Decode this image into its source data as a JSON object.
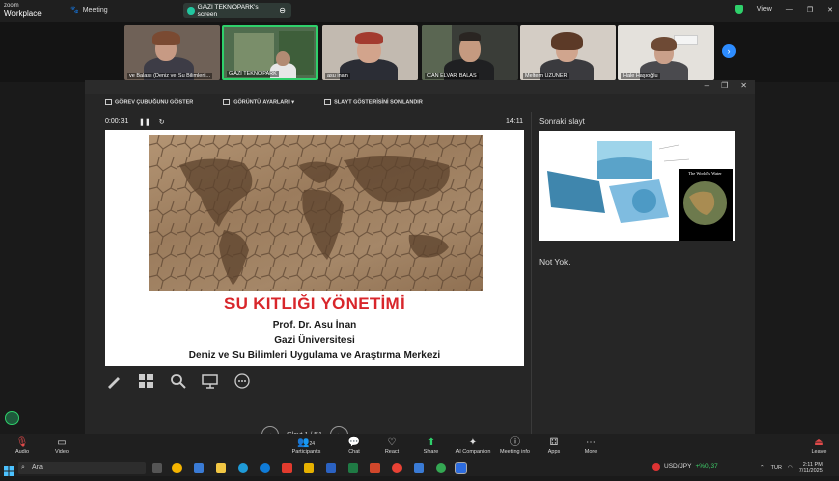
{
  "zoom": {
    "brand_line1": "zoom",
    "brand_line2": "Workplace",
    "meeting_label": "Meeting",
    "screen_tab": "GAZI TEKNOPARK's screen",
    "view_label": "View"
  },
  "participants": [
    {
      "name": "ve Balası (Deniz ve Su Bilimleri...",
      "bg": "#7b6d62"
    },
    {
      "name": "GAZI TEKNOPARK",
      "bg": "#4f6a4a"
    },
    {
      "name": "asu inan",
      "bg": "#b9b0a4"
    },
    {
      "name": "CAN ELVAR BALAS",
      "bg": "#3b3f3a"
    },
    {
      "name": "Meltem UZUNER",
      "bg": "#cfc6bd"
    },
    {
      "name": "Hale Haşıoğlu",
      "bg": "#e2dfda"
    }
  ],
  "presenter": {
    "toolbar": {
      "taskbar": "GÖREV ÇUBUĞUNU GÖSTER",
      "display": "GÖRÜNTÜ AYARLARI ▾",
      "end": "SLAYT GÖSTERİSİNİ SONLANDIR"
    },
    "timer": "0:00:31",
    "clock": "14:11",
    "next_slide_label": "Sonraki slayt",
    "notes": "Not Yok.",
    "nav_text": "Slayt 1 / 51"
  },
  "slide": {
    "title": "SU KITLIĞI YÖNETİMİ",
    "author": "Prof. Dr. Asu İnan",
    "university": "Gazi Üniversitesi",
    "center": "Deniz ve Su Bilimleri Uygulama ve Araştırma Merkezi"
  },
  "next_slide": {
    "globe_caption": "The World's Water"
  },
  "toolbar": [
    {
      "label": "Audio",
      "icon": "mic-off-icon"
    },
    {
      "label": "Video",
      "icon": "camera-icon"
    },
    {
      "label": "Participants",
      "icon": "people-icon",
      "count": "24"
    },
    {
      "label": "Chat",
      "icon": "chat-icon"
    },
    {
      "label": "React",
      "icon": "heart-icon"
    },
    {
      "label": "Share",
      "icon": "share-icon"
    },
    {
      "label": "AI Companion",
      "icon": "sparkle-icon"
    },
    {
      "label": "Meeting info",
      "icon": "info-icon"
    },
    {
      "label": "Apps",
      "icon": "apps-icon"
    },
    {
      "label": "More",
      "icon": "more-icon"
    },
    {
      "label": "Leave",
      "icon": "leave-icon"
    }
  ],
  "taskbar": {
    "search_placeholder": "Ara",
    "ticker": "USD/JPY",
    "ticker_change": "+%0,37",
    "lang": "TUR",
    "time": "2:11 PM",
    "date": "7/11/2025"
  },
  "colors": {
    "accent": "#2d8cff",
    "title_red": "#d8262b",
    "active_green": "#2fd06b"
  }
}
